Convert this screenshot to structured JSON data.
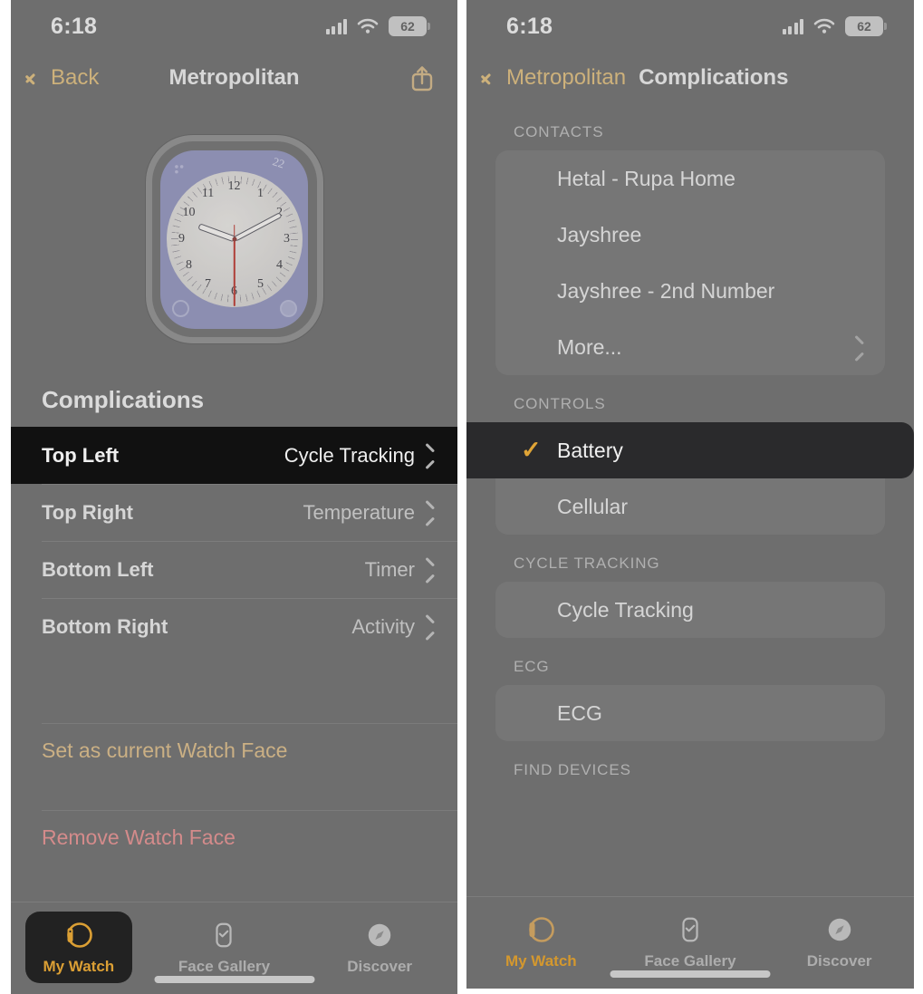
{
  "status": {
    "time": "6:18",
    "battery_percent": "62",
    "signal_icon": "cellular-bars-icon",
    "wifi_icon": "wifi-icon",
    "battery_icon": "battery-icon"
  },
  "left_panel": {
    "nav": {
      "back_label": "Back",
      "title": "Metropolitan",
      "back_icon": "chevron-left-icon",
      "share_icon": "share-icon"
    },
    "watch_preview": {
      "face_name": "Metropolitan",
      "dial_numbers": [
        "12",
        "1",
        "2",
        "3",
        "4",
        "5",
        "6",
        "7",
        "8",
        "9",
        "10",
        "11"
      ],
      "corner_label": "22",
      "complication_icons": [
        "cycle-tracking-complication-icon",
        "temperature-complication-icon",
        "timer-complication-icon",
        "activity-complication-icon"
      ]
    },
    "section_title": "Complications",
    "rows": [
      {
        "label": "Top Left",
        "value": "Cycle Tracking",
        "selected": true
      },
      {
        "label": "Top Right",
        "value": "Temperature",
        "selected": false
      },
      {
        "label": "Bottom Left",
        "value": "Timer",
        "selected": false
      },
      {
        "label": "Bottom Right",
        "value": "Activity",
        "selected": false
      }
    ],
    "actions": [
      {
        "label": "Set as current Watch Face",
        "style": "gold"
      },
      {
        "label": "Remove Watch Face",
        "style": "red"
      }
    ],
    "tabs": [
      {
        "label": "My Watch",
        "icon": "watch-icon",
        "active": true,
        "boxed": true
      },
      {
        "label": "Face Gallery",
        "icon": "watch-face-icon",
        "active": false,
        "boxed": false
      },
      {
        "label": "Discover",
        "icon": "compass-icon",
        "active": false,
        "boxed": false
      }
    ]
  },
  "right_panel": {
    "nav": {
      "back_label": "Metropolitan",
      "title": "Complications",
      "back_icon": "chevron-left-icon"
    },
    "groups": [
      {
        "header": "CONTACTS",
        "items": [
          {
            "label": "Hetal - Rupa Home",
            "checked": false,
            "chevron": false
          },
          {
            "label": "Jayshree",
            "checked": false,
            "chevron": false
          },
          {
            "label": "Jayshree - 2nd Number",
            "checked": false,
            "chevron": false
          },
          {
            "label": "More...",
            "checked": false,
            "chevron": true
          }
        ]
      },
      {
        "header": "CONTROLS",
        "items": [
          {
            "label": "Battery",
            "checked": true,
            "chevron": false
          },
          {
            "label": "Cellular",
            "checked": false,
            "chevron": false
          }
        ]
      },
      {
        "header": "CYCLE TRACKING",
        "items": [
          {
            "label": "Cycle Tracking",
            "checked": false,
            "chevron": false
          }
        ]
      },
      {
        "header": "ECG",
        "items": [
          {
            "label": "ECG",
            "checked": false,
            "chevron": false
          }
        ]
      },
      {
        "header": "FIND DEVICES",
        "items": []
      }
    ],
    "checkmark_glyph": "✓",
    "tabs": [
      {
        "label": "My Watch",
        "icon": "watch-icon",
        "active": true,
        "boxed": false
      },
      {
        "label": "Face Gallery",
        "icon": "watch-face-icon",
        "active": false,
        "boxed": false
      },
      {
        "label": "Discover",
        "icon": "compass-icon",
        "active": false,
        "boxed": false
      }
    ]
  },
  "colors": {
    "panel_background": "#6b6b6b",
    "card_background": "#757575",
    "selected_row_left": "#000000",
    "selected_row_right": "#1d1d20",
    "accent_gold": "#d8b87a",
    "accent_orange": "#eda92b",
    "destructive_red": "#e08d8d",
    "primary_text": "#e4e4e4",
    "secondary_text": "#c9c9c9"
  }
}
